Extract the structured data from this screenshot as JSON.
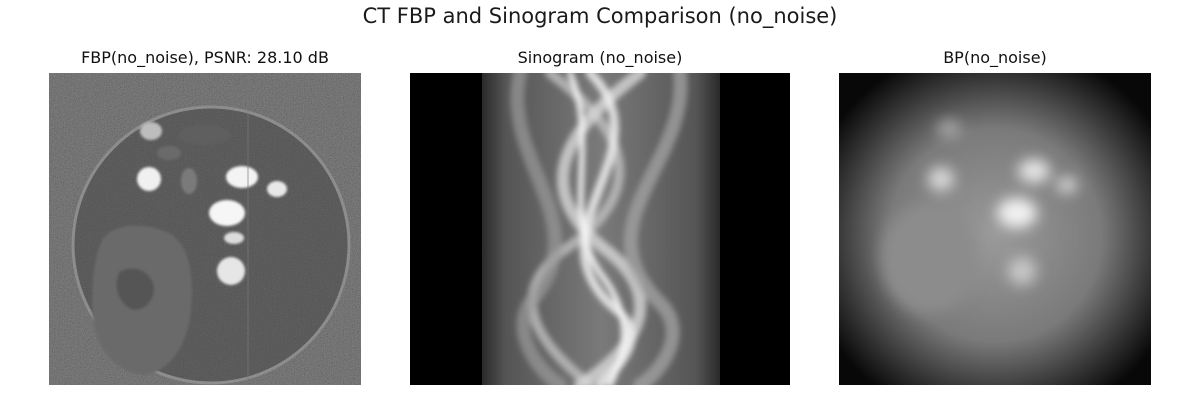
{
  "figure": {
    "title": "CT FBP and Sinogram Comparison (no_noise)"
  },
  "panels": [
    {
      "title": "FBP(no_noise), PSNR: 28.10 dB",
      "image": "fbp-reconstruction"
    },
    {
      "title": "Sinogram (no_noise)",
      "image": "sinogram"
    },
    {
      "title": "BP(no_noise)",
      "image": "backprojection"
    }
  ]
}
